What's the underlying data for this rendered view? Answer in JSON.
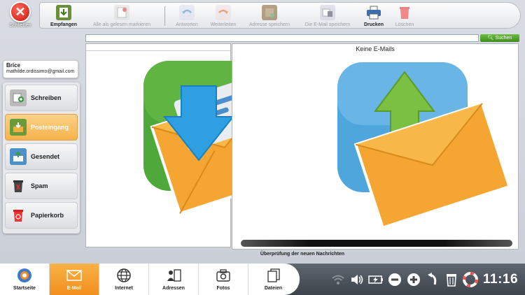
{
  "close": {
    "label": "Schließen"
  },
  "toolbar": {
    "items": [
      {
        "label": "Empfangen"
      },
      {
        "label": "Alle als gelesen markieren"
      },
      {
        "label": "Antworten"
      },
      {
        "label": "Weiterleiten"
      },
      {
        "label": "Adresse speichern"
      },
      {
        "label": "Die E-Mail speichern"
      },
      {
        "label": "Drucken"
      },
      {
        "label": "Löschen"
      }
    ]
  },
  "search": {
    "button_label": "Suchen",
    "value": ""
  },
  "user": {
    "name": "Brice",
    "email": "mathilde.ordissimo@gmail.com"
  },
  "sidebar": {
    "items": [
      {
        "label": "Schreiben"
      },
      {
        "label": "Posteingang"
      },
      {
        "label": "Gesendet"
      },
      {
        "label": "Spam"
      },
      {
        "label": "Papierkorb"
      }
    ]
  },
  "preview": {
    "empty_text": "Keine E-Mails"
  },
  "status": {
    "text": "Überprüfung der neuen Nachrichten",
    "progress": 1.0
  },
  "apps": [
    {
      "label": "Startseite"
    },
    {
      "label": "E-Mail"
    },
    {
      "label": "Internet"
    },
    {
      "label": "Adressen"
    },
    {
      "label": "Fotos"
    },
    {
      "label": "Dateien"
    }
  ],
  "clock": "11:16",
  "colors": {
    "accent": "#f4a032",
    "close": "#d8221a",
    "search": "#4a9a28",
    "inbox_green": "#4fa83a",
    "sent_blue": "#4ea6dd"
  }
}
